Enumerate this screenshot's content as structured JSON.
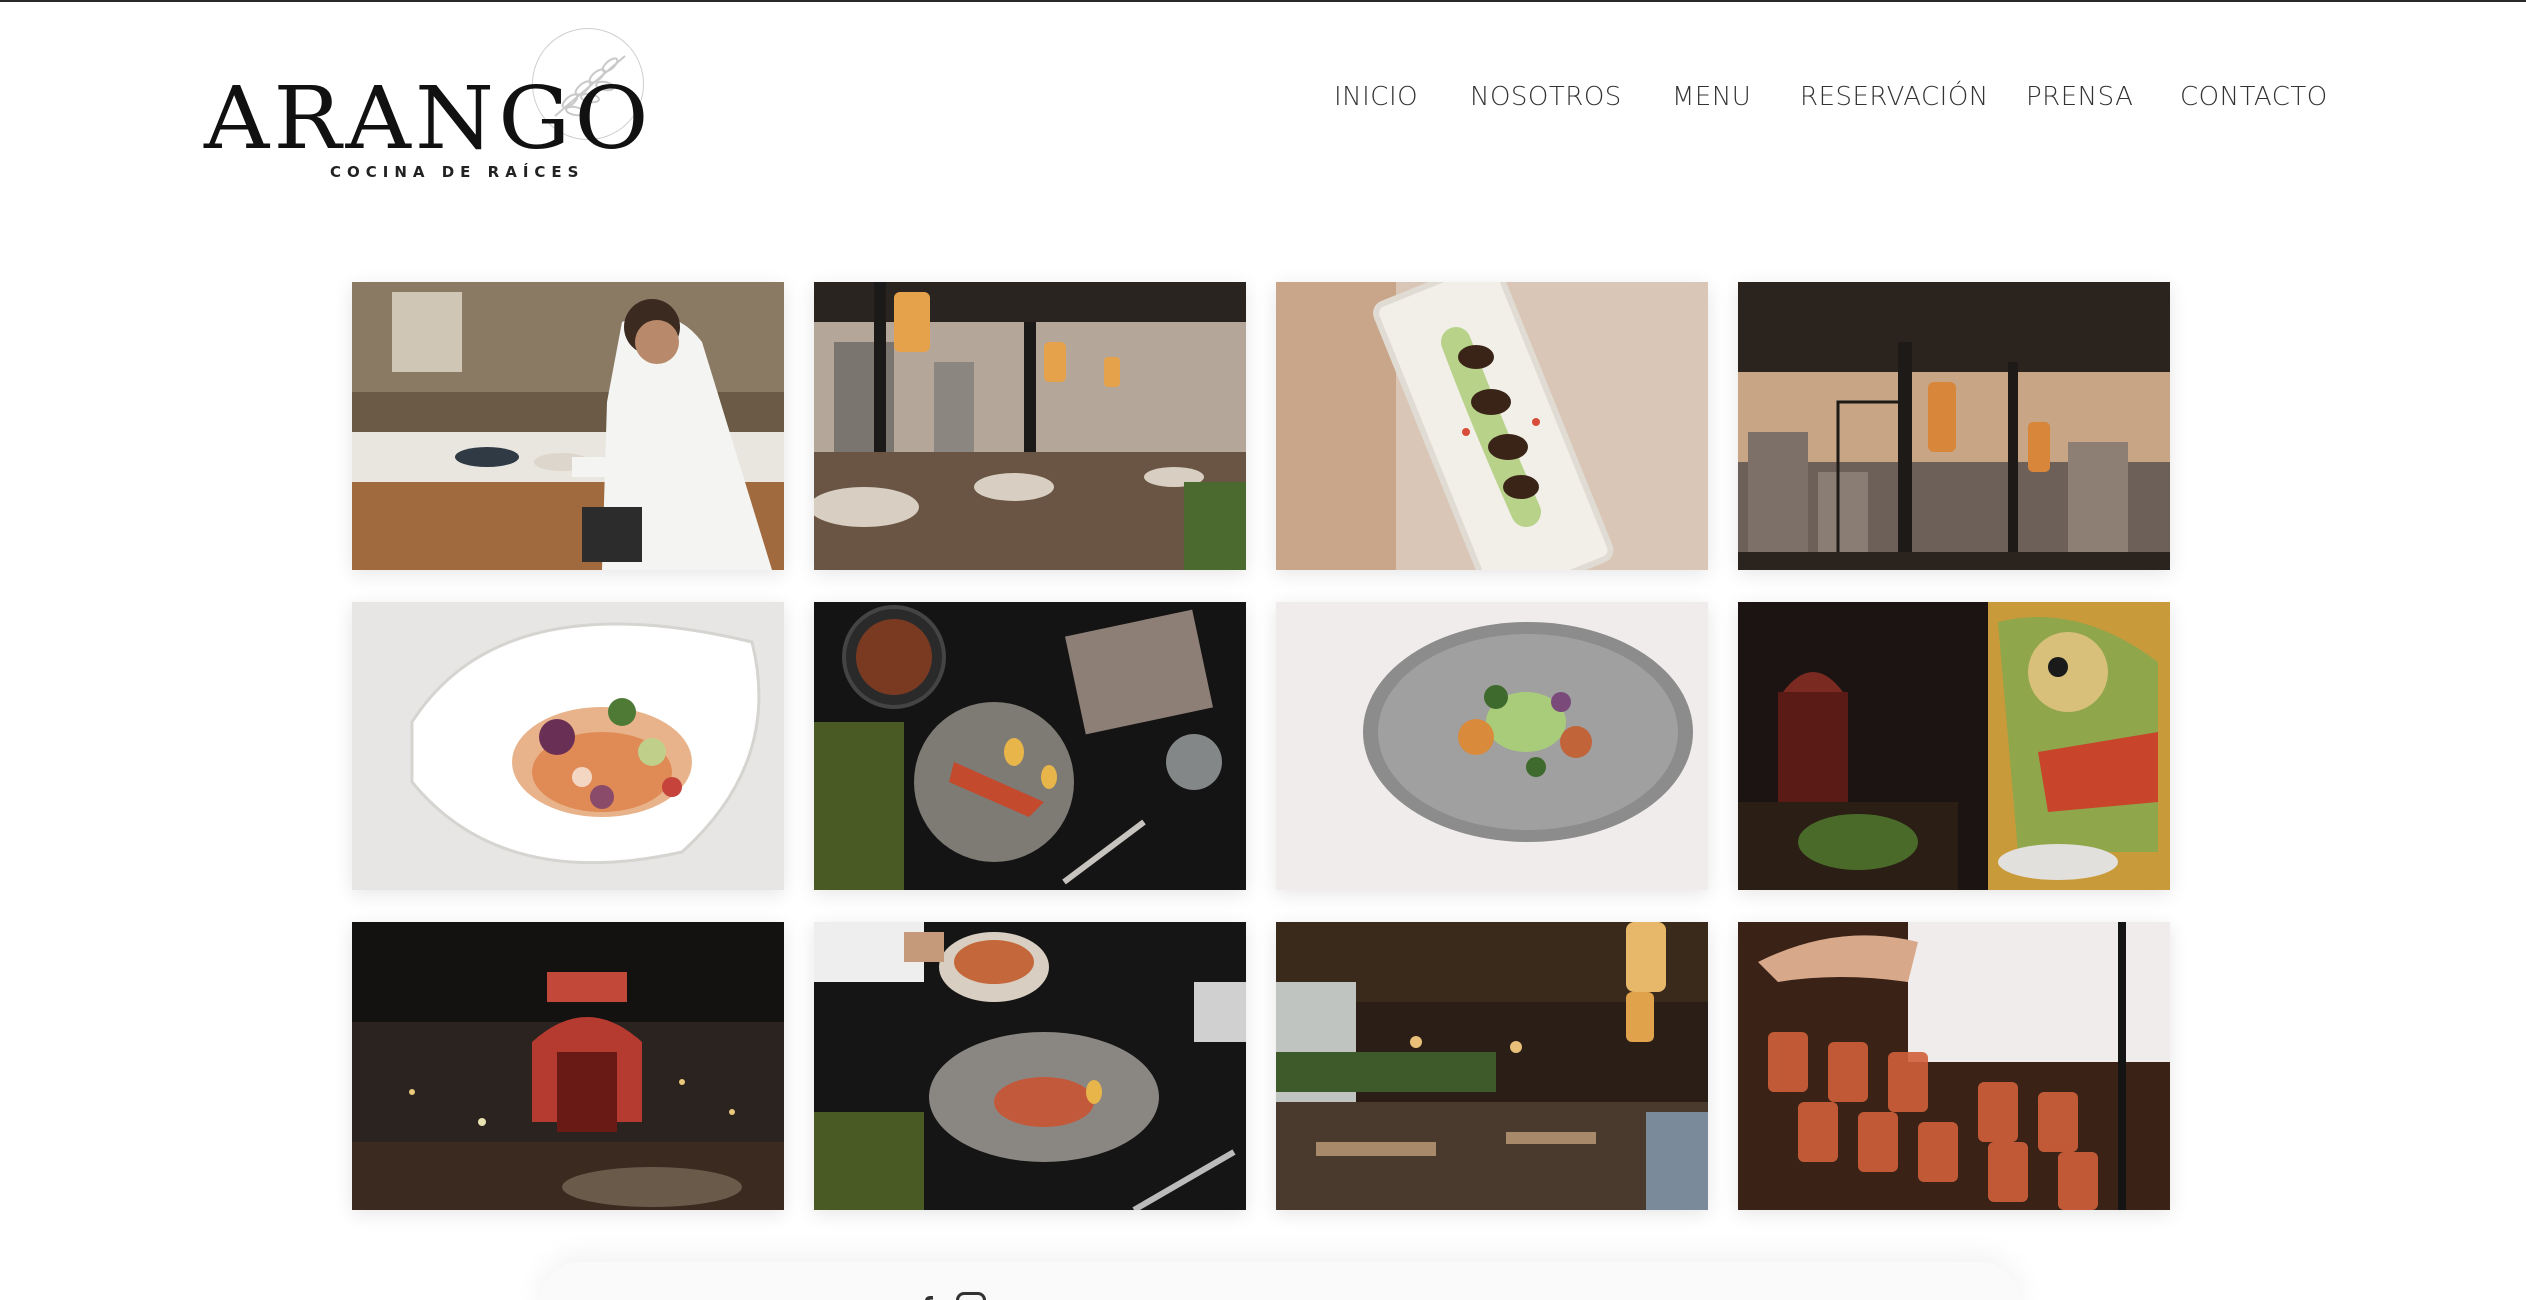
{
  "brand": {
    "name": "ARANGO",
    "tagline": "COCINA DE RAÍCES"
  },
  "nav": {
    "items": [
      {
        "label": "INICIO"
      },
      {
        "label": "NOSOTROS"
      },
      {
        "label": "MENU"
      },
      {
        "label": "RESERVACIÓN"
      },
      {
        "label": "PRENSA"
      },
      {
        "label": "CONTACTO"
      }
    ]
  },
  "gallery": {
    "photos": [
      {
        "subject": "chef-plating-photo"
      },
      {
        "subject": "terrace-dining-photo"
      },
      {
        "subject": "plated-dish-photo"
      },
      {
        "subject": "terrace-sunset-photo"
      },
      {
        "subject": "salad-bowl-photo"
      },
      {
        "subject": "table-dishes-photo"
      },
      {
        "subject": "gray-plate-dish-photo"
      },
      {
        "subject": "mural-terrace-photo"
      },
      {
        "subject": "monument-night-photo"
      },
      {
        "subject": "serving-dish-photo"
      },
      {
        "subject": "dining-room-photo"
      },
      {
        "subject": "cocktails-bar-photo"
      }
    ]
  },
  "colors": {
    "text": "#333333",
    "logo": "#111111",
    "background": "#ffffff"
  }
}
